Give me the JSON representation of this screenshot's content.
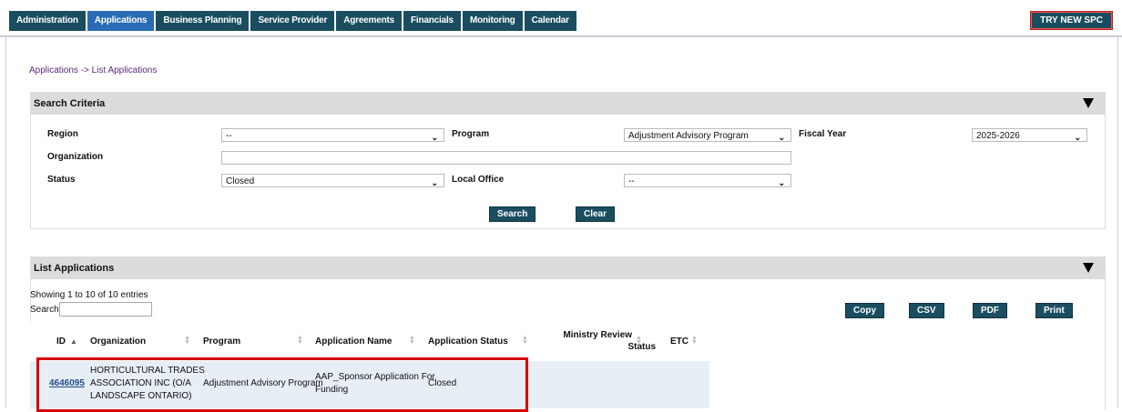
{
  "nav": {
    "tabs": [
      {
        "label": "Administration",
        "active": false
      },
      {
        "label": "Applications",
        "active": true
      },
      {
        "label": "Business Planning",
        "active": false
      },
      {
        "label": "Service Provider",
        "active": false
      },
      {
        "label": "Agreements",
        "active": false
      },
      {
        "label": "Financials",
        "active": false
      },
      {
        "label": "Monitoring",
        "active": false
      },
      {
        "label": "Calendar",
        "active": false
      }
    ],
    "try_new": "TRY NEW SPC"
  },
  "breadcrumb": {
    "part1": "Applications",
    "sep": "->",
    "part2": "List Applications"
  },
  "search": {
    "title": "Search Criteria",
    "region_label": "Region",
    "region_value": "--",
    "program_label": "Program",
    "program_value": "Adjustment Advisory Program",
    "fiscal_label": "Fiscal Year",
    "fiscal_value": "2025-2026",
    "org_label": "Organization",
    "org_value": "",
    "status_label": "Status",
    "status_value": "Closed",
    "office_label": "Local Office",
    "office_value": "--",
    "search_btn": "Search",
    "clear_btn": "Clear"
  },
  "list": {
    "title": "List Applications",
    "showing": "Showing 1 to 10 of 10 entries",
    "search_label": "Search:",
    "buttons": {
      "copy": "Copy",
      "csv": "CSV",
      "pdf": "PDF",
      "print": "Print"
    },
    "columns": {
      "id": "ID",
      "org": "Organization",
      "program": "Program",
      "name": "Application Name",
      "status": "Application Status",
      "ministry1": "Ministry Review",
      "ministry2": "Status",
      "etc": "ETC"
    },
    "rows": [
      {
        "id": "4646095",
        "org1": "HORTICULTURAL TRADES",
        "org2": "ASSOCIATION INC (O/A",
        "org3": "LANDSCAPE ONTARIO)",
        "program": "Adjustment Advisory Program",
        "name1": "AAP_Sponsor Application For",
        "name2": "Funding",
        "status": "Closed"
      }
    ]
  },
  "colors": {
    "nav": "#1a4d5f",
    "nav_active": "#2a6bb5",
    "highlight": "#d40000"
  }
}
